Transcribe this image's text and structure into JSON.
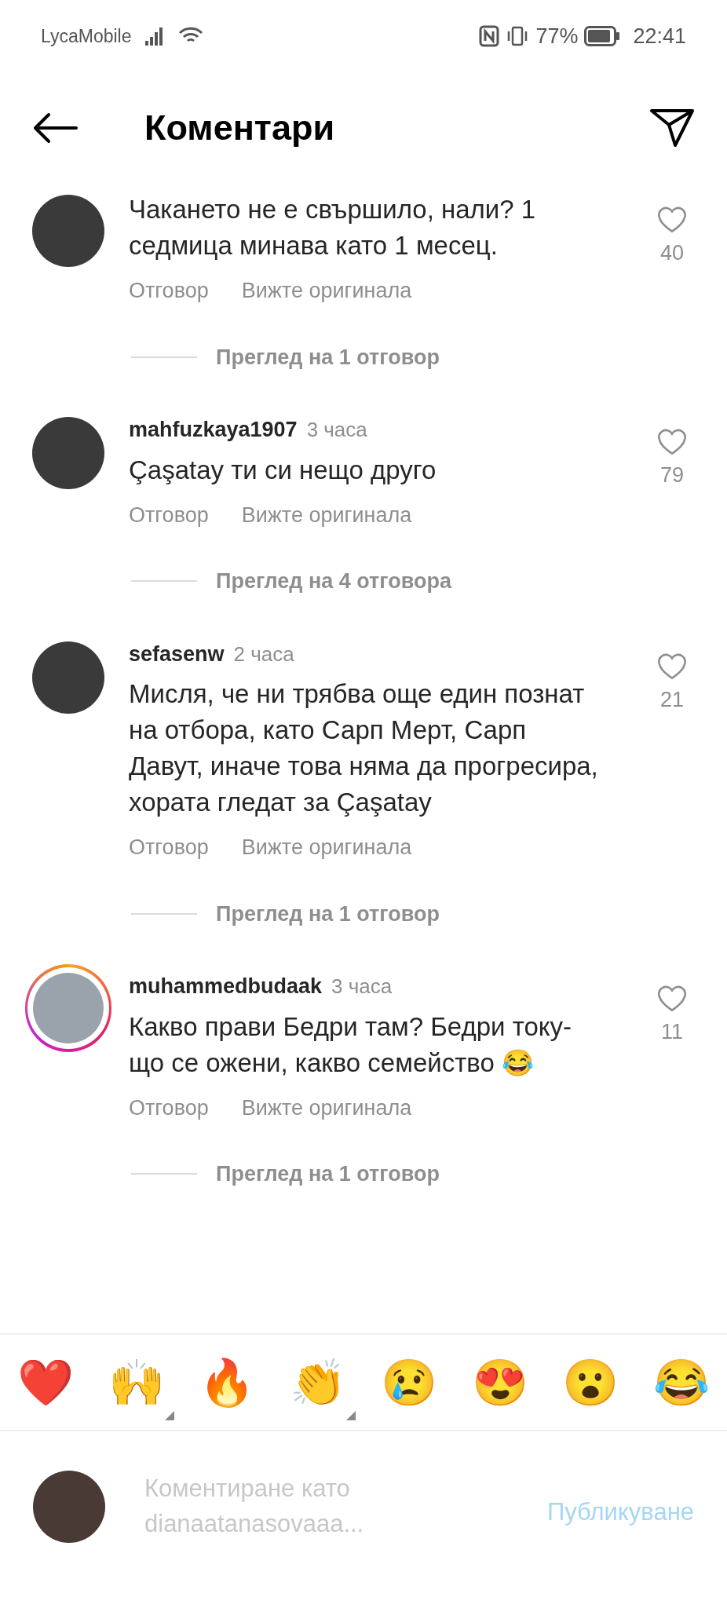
{
  "status_bar": {
    "carrier": "LycaMobile",
    "battery": "77%",
    "time": "22:41"
  },
  "header": {
    "title": "Коментари"
  },
  "comments": [
    {
      "text": "Чакането не е свършило, нали? 1 седмица минава като 1 месец.",
      "likes": "40",
      "story": false,
      "actions": [
        "Отговор",
        "Вижте оригинала"
      ],
      "replies": "Преглед на 1 отговор"
    },
    {
      "username": "mahfuzkaya1907",
      "time": "3 часа",
      "text": "Çaşatay ти си нещо друго",
      "likes": "79",
      "story": false,
      "actions": [
        "Отговор",
        "Вижте оригинала"
      ],
      "replies": "Преглед на 4 отговора"
    },
    {
      "username": "sefasenw",
      "time": "2 часа",
      "text": "Мисля, че ни трябва още един познат на отбора, като Сарп Мерт, Сарп Давут, иначе това няма да прогресира, хората гледат за Çaşatay",
      "likes": "21",
      "story": false,
      "actions": [
        "Отговор",
        "Вижте оригинала"
      ],
      "replies": "Преглед на 1 отговор"
    },
    {
      "username": "muhammedbudaak",
      "time": "3 часа",
      "text": "Какво прави Бедри там? Бедри току-що се ожени, какво семейство 😂",
      "likes": "11",
      "story": true,
      "actions": [
        "Отговор",
        "Вижте оригинала"
      ],
      "replies": "Преглед на 1 отговор"
    }
  ],
  "reactions": [
    {
      "emoji": "❤️",
      "has_variants": false
    },
    {
      "emoji": "🙌",
      "has_variants": true
    },
    {
      "emoji": "🔥",
      "has_variants": false
    },
    {
      "emoji": "👏",
      "has_variants": true
    },
    {
      "emoji": "😢",
      "has_variants": false
    },
    {
      "emoji": "😍",
      "has_variants": false
    },
    {
      "emoji": "😮",
      "has_variants": false
    },
    {
      "emoji": "😂",
      "has_variants": false
    }
  ],
  "composer": {
    "placeholder": "Коментиране като dianaatanasovaaa...",
    "post_button": "Публикуване"
  }
}
